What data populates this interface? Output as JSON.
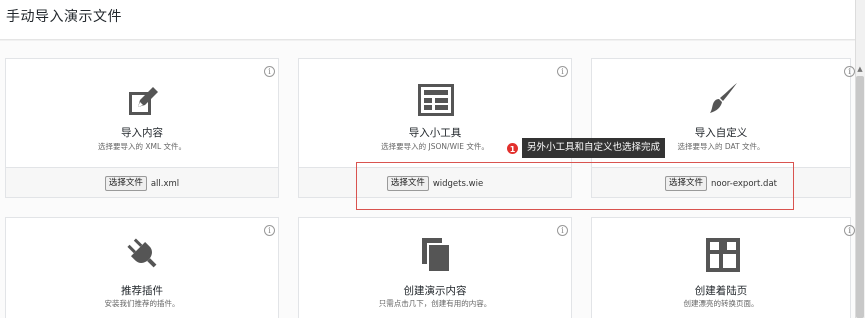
{
  "page": {
    "title": "手动导入演示文件"
  },
  "cards": [
    {
      "title": "导入内容",
      "desc": "选择要导入的 XML 文件。",
      "button": "选择文件",
      "file": "all.xml",
      "icon": "edit-icon"
    },
    {
      "title": "导入小工具",
      "desc": "选择要导入的 JSON/WIE 文件。",
      "button": "选择文件",
      "file": "widgets.wie",
      "icon": "widgets-icon"
    },
    {
      "title": "导入自定义",
      "desc": "选择要导入的 DAT 文件。",
      "button": "选择文件",
      "file": "noor-export.dat",
      "icon": "brush-icon"
    },
    {
      "title": "推荐插件",
      "desc": "安装我们推荐的插件。",
      "icon": "plug-icon"
    },
    {
      "title": "创建演示内容",
      "desc": "只需点击几下，创建有用的内容。",
      "icon": "pages-icon"
    },
    {
      "title": "创建着陆页",
      "desc": "创建漂亮的转换页面。",
      "icon": "layout-icon"
    }
  ],
  "info_glyph": "i",
  "annotation": {
    "badge": "1",
    "text": "另外小工具和自定义也选择完成",
    "color": "#d9534f"
  }
}
